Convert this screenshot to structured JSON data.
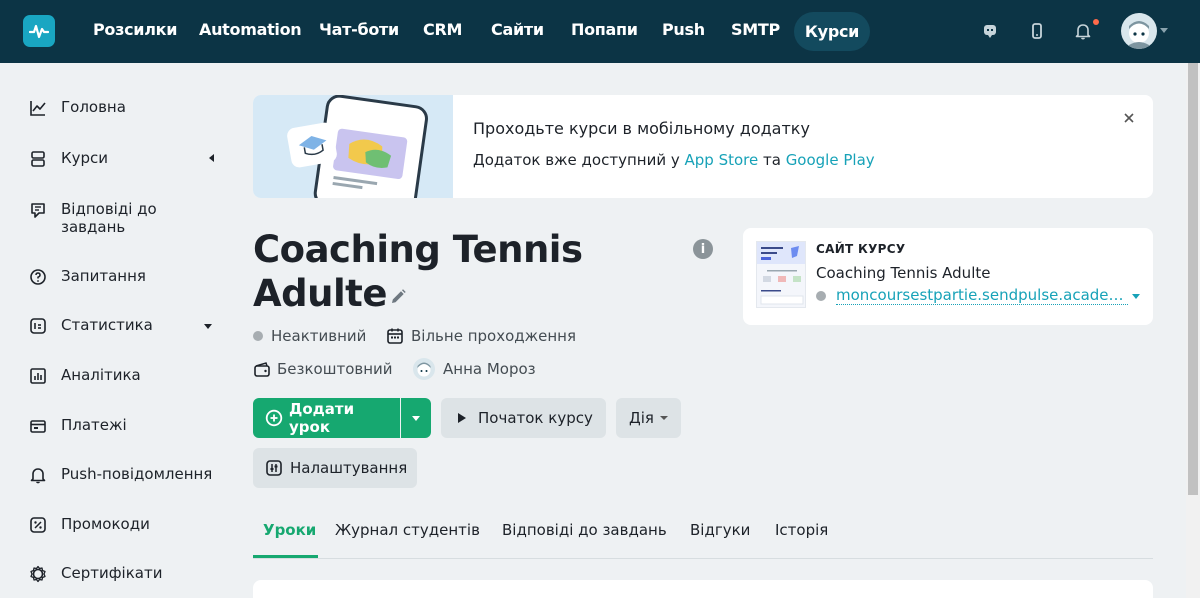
{
  "topnav": {
    "items": [
      "Розсилки",
      "Automation",
      "Чат-боти",
      "CRM",
      "Сайти",
      "Попапи",
      "Push",
      "SMTP"
    ],
    "active": "Курси",
    "icons": [
      "chat-icon",
      "mobile-icon",
      "bell-icon"
    ],
    "colors": {
      "bg": "#0c3445",
      "active_bg": "#134a5e",
      "notification_dot": "#ff6a4a"
    }
  },
  "sidebar": {
    "items": [
      {
        "label": "Головна",
        "icon": "chart-line-icon"
      },
      {
        "label": "Курси",
        "icon": "layers-icon"
      },
      {
        "label": "Відповіді до завдань",
        "icon": "answers-icon"
      },
      {
        "label": "Запитання",
        "icon": "question-icon"
      },
      {
        "label": "Статистика",
        "icon": "stats-icon"
      },
      {
        "label": "Аналітика",
        "icon": "analytics-icon"
      },
      {
        "label": "Платежі",
        "icon": "wallet-icon"
      },
      {
        "label": "Push-повідомлення",
        "icon": "bell-icon"
      },
      {
        "label": "Промокоди",
        "icon": "promo-icon"
      },
      {
        "label": "Сертифікати",
        "icon": "certificate-icon"
      }
    ]
  },
  "banner": {
    "title": "Проходьте курси в мобільному додатку",
    "text_prefix": "Додаток вже доступний у ",
    "app_store": "App Store",
    "text_middle": " та ",
    "google_play": "Google Play"
  },
  "course": {
    "title": "Coaching Tennis Adulte",
    "status": "Неактивний",
    "mode": "Вільне проходження",
    "price": "Безкоштовний",
    "author": "Анна Мороз"
  },
  "actions": {
    "add_lesson": "Додати урок",
    "start_course": "Початок курсу",
    "action": "Дія",
    "settings": "Налаштування"
  },
  "course_site": {
    "label": "САЙТ КУРСУ",
    "name": "Coaching Tennis Adulte",
    "url": "moncoursestpartie.sendpulse.academy"
  },
  "tabs": [
    "Уроки",
    "Журнал студентів",
    "Відповіді до завдань",
    "Відгуки",
    "Історія"
  ],
  "accent": "#16a870",
  "link_color": "#17a2b8"
}
